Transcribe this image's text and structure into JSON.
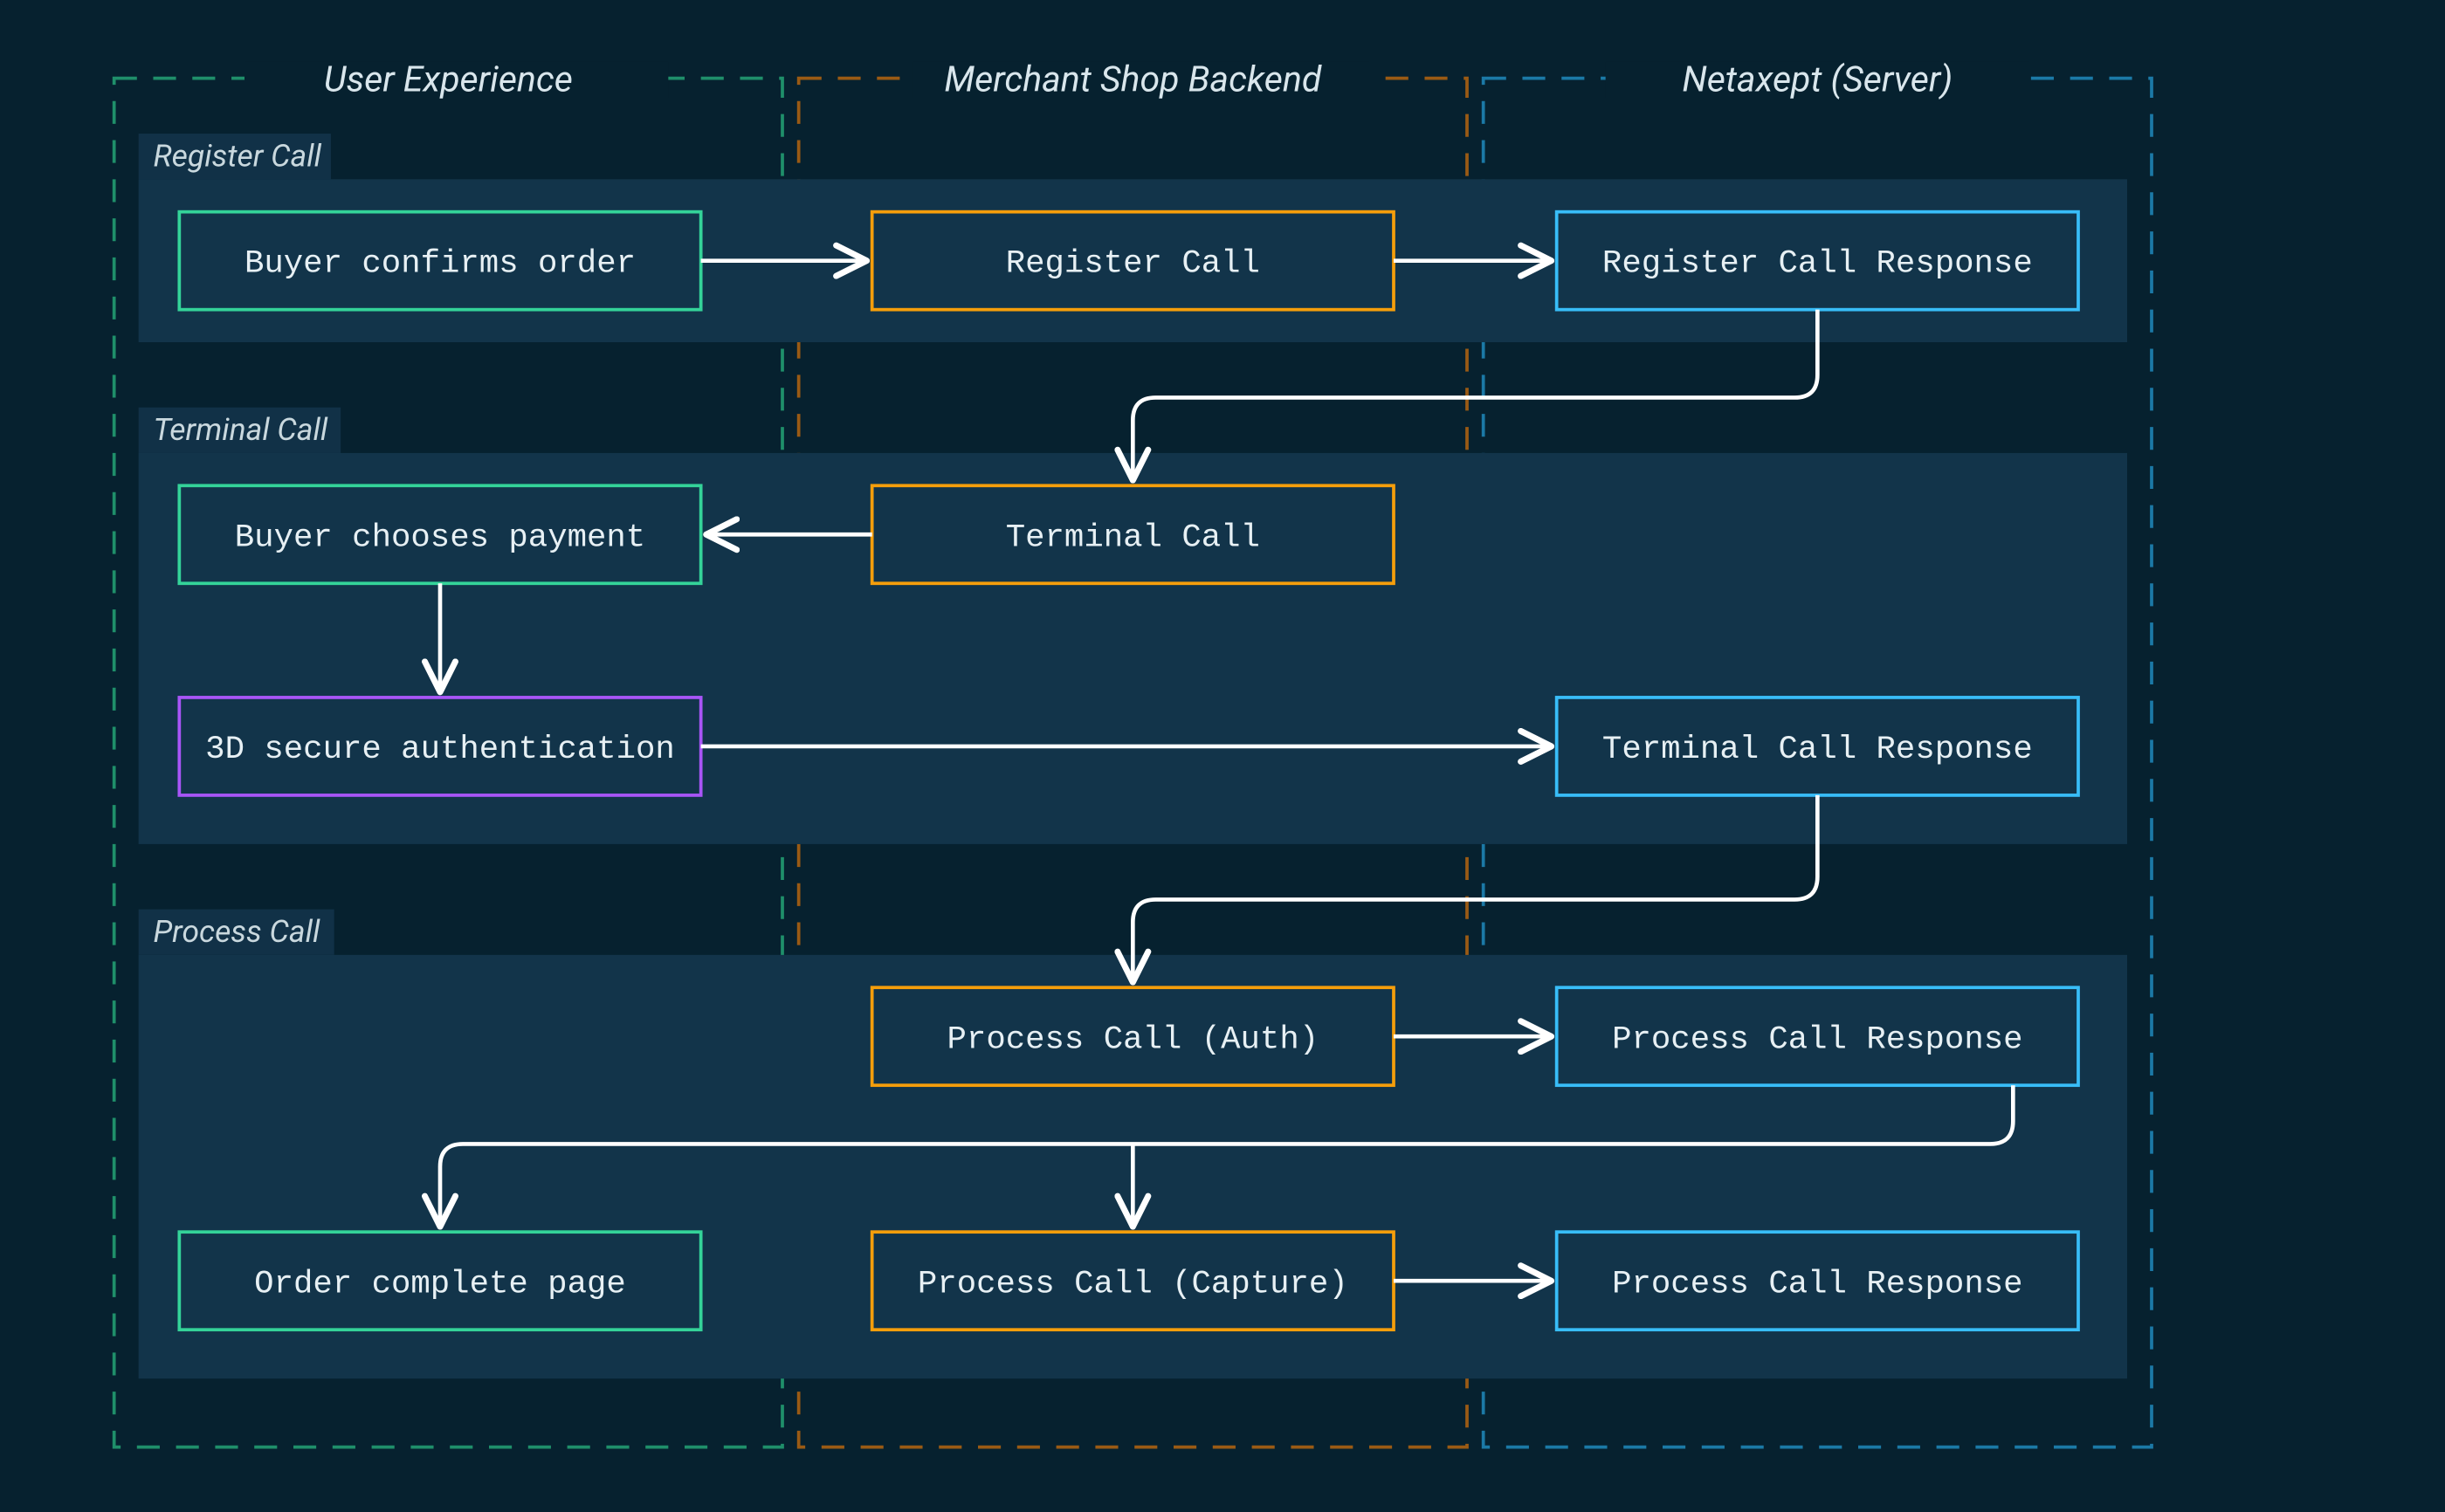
{
  "swimlanes": {
    "user": "User Experience",
    "backend": "Merchant Shop Backend",
    "server": "Netaxept (Server)"
  },
  "sections": {
    "register": "Register Call",
    "terminal": "Terminal Call",
    "process": "Process Call"
  },
  "nodes": {
    "buyer_confirms": "Buyer confirms order",
    "register_call": "Register Call",
    "register_resp": "Register Call Response",
    "terminal_call": "Terminal Call",
    "buyer_chooses": "Buyer chooses payment",
    "threeds": "3D secure authentication",
    "terminal_resp": "Terminal Call Response",
    "process_auth": "Process Call (Auth)",
    "process_resp1": "Process Call Response",
    "order_complete": "Order complete page",
    "process_capture": "Process Call (Capture)",
    "process_resp2": "Process Call Response"
  },
  "colors": {
    "background": "#06212f",
    "panel": "#12344a",
    "green": "#34d399",
    "orange": "#f59e0b",
    "blue": "#38bdf8",
    "purple": "#a855f7",
    "arrow": "#ffffff"
  }
}
